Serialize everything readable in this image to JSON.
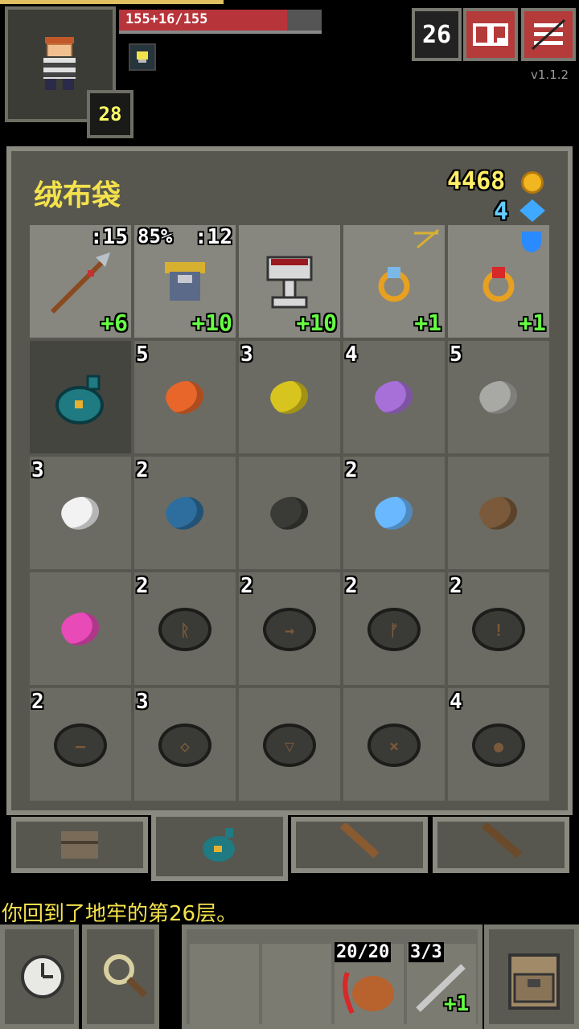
{
  "hero": {
    "hp_text": "155+16/155",
    "level": "28",
    "hp_fraction": 0.83
  },
  "top": {
    "depth": "26",
    "version": "v1.1.2",
    "journal_icon": "journal-icon",
    "menu_icon": "menu-icon"
  },
  "bag": {
    "title": "绒布袋",
    "gold": "4468",
    "energy": "4"
  },
  "equipment": [
    {
      "name": "spear",
      "top_left": "",
      "top_right": ":15",
      "upgrade": "+6"
    },
    {
      "name": "armor",
      "top_left": "85%",
      "top_right": ":12",
      "upgrade": "+10"
    },
    {
      "name": "artifact-chalice",
      "top_left": "",
      "top_right": "",
      "upgrade": "+10"
    },
    {
      "name": "ring-topaz",
      "top_left": "",
      "top_right": "",
      "upgrade": "+1"
    },
    {
      "name": "ring-garnet",
      "top_left": "",
      "top_right": "",
      "upgrade": "+1"
    }
  ],
  "items": [
    {
      "name": "velvet-pouch",
      "qty": "",
      "kind": "pouch"
    },
    {
      "name": "orange-seed",
      "qty": "5",
      "kind": "gem",
      "color": "#e8662a"
    },
    {
      "name": "yellow-seed",
      "qty": "3",
      "kind": "gem",
      "color": "#d8c41e"
    },
    {
      "name": "purple-seed",
      "qty": "4",
      "kind": "gem",
      "color": "#a670d8"
    },
    {
      "name": "grey-seed",
      "qty": "5",
      "kind": "gem",
      "color": "#a8a8a4"
    },
    {
      "name": "white-seed",
      "qty": "3",
      "kind": "gem",
      "color": "#f2f2f2"
    },
    {
      "name": "blue-seed",
      "qty": "2",
      "kind": "gem",
      "color": "#2e6e9e"
    },
    {
      "name": "black-seed",
      "qty": "",
      "kind": "gem",
      "color": "#3a3a36"
    },
    {
      "name": "light-blue-seed",
      "qty": "2",
      "kind": "gem",
      "color": "#6ab8ff"
    },
    {
      "name": "brown-seed",
      "qty": "",
      "kind": "gem",
      "color": "#7a5a3a"
    },
    {
      "name": "pink-seed",
      "qty": "",
      "kind": "gem",
      "color": "#e84ab8"
    },
    {
      "name": "runestone-1",
      "qty": "2",
      "kind": "stone",
      "glyph": "ᚱ"
    },
    {
      "name": "runestone-2",
      "qty": "2",
      "kind": "stone",
      "glyph": "→"
    },
    {
      "name": "runestone-3",
      "qty": "2",
      "kind": "stone",
      "glyph": "ᚠ"
    },
    {
      "name": "runestone-4",
      "qty": "2",
      "kind": "stone",
      "glyph": "!"
    },
    {
      "name": "runestone-5",
      "qty": "2",
      "kind": "stone",
      "glyph": "–"
    },
    {
      "name": "runestone-6",
      "qty": "3",
      "kind": "stone",
      "glyph": "◇"
    },
    {
      "name": "runestone-7",
      "qty": "",
      "kind": "stone",
      "glyph": "▽"
    },
    {
      "name": "runestone-8",
      "qty": "",
      "kind": "stone",
      "glyph": "×"
    },
    {
      "name": "runestone-9",
      "qty": "4",
      "kind": "stone",
      "glyph": "●"
    }
  ],
  "log": "你回到了地牢的第26层。",
  "quickslots": {
    "slot3_count": "20/20",
    "slot4_count": "3/3",
    "slot4_upgrade": "+1"
  }
}
